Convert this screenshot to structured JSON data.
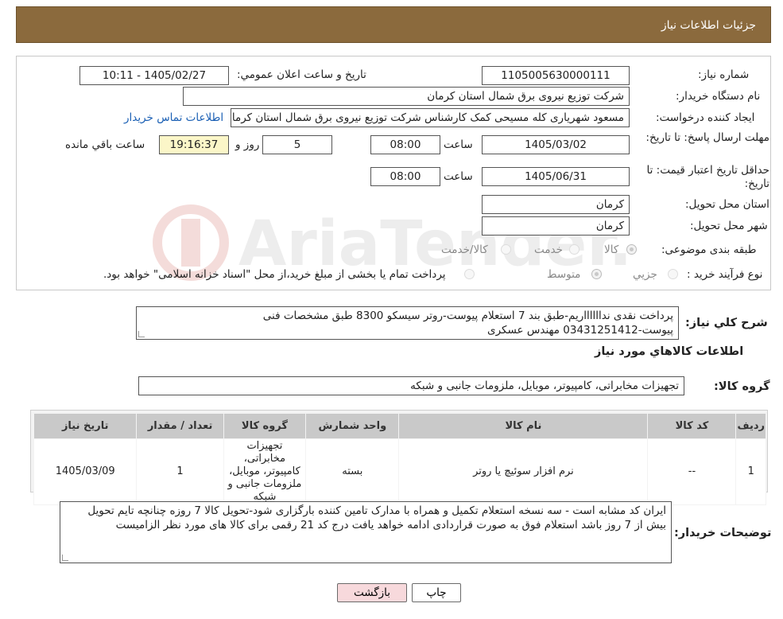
{
  "header": {
    "title": "جزئیات اطلاعات نیاز"
  },
  "form": {
    "need_number_label": "شماره نیاز:",
    "need_number": "1105005630000111",
    "announce_label": "تاریخ و ساعت اعلان عمومي:",
    "announce_value": "1405/02/27 - 10:11",
    "buyer_org_label": "نام دستگاه خریدار:",
    "buyer_org": "شرکت توزیع نیروی برق شمال استان کرمان",
    "requester_label": "ایجاد کننده درخواست:",
    "requester": "مسعود شهریاری کله مسیحی کمک کارشناس شرکت توزیع نیروی برق شمال استان کرمان",
    "contact_link": "اطلاعات تماس خریدار",
    "reply_deadline_label": "مهلت ارسال پاسخ: تا تاریخ:",
    "reply_date": "1405/03/02",
    "time_label": "ساعت",
    "reply_time": "08:00",
    "days_value": "5",
    "days_label": "روز و",
    "remaining_time": "19:16:37",
    "remaining_label": "ساعت باقي مانده",
    "validity_label": "حداقل تاریخ اعتبار قیمت: تا تاریخ:",
    "validity_date": "1405/06/31",
    "validity_time": "08:00",
    "province_label": "استان محل تحویل:",
    "province": "کرمان",
    "city_label": "شهر محل تحویل:",
    "city": "کرمان",
    "category_label": "طبقه بندی موضوعی:",
    "category_options": [
      "کالا",
      "خدمت",
      "کالا/خدمت"
    ],
    "process_label": "نوع فرآیند خرید :",
    "process_options": [
      "جزیي",
      "متوسط"
    ],
    "process_note": "پرداخت تمام یا بخشی از مبلغ خرید،از محل \"اسناد خزانه اسلامی\" خواهد بود."
  },
  "summary": {
    "label": "شرح كلي نياز:",
    "line1": "پرداخت نقدی ندااااااریم-طبق بند 7 استعلام پیوست-روتر سیسکو 8300 طبق مشخصات فنی",
    "line2": "پیوست-03431251412 مهندس عسکری"
  },
  "goods_section": {
    "title": "اطلاعات كالاهاي مورد نياز",
    "group_label": "گروه كالا:",
    "group_value": "تجهیزات مخابراتی، کامپیوتر، موبایل، ملزومات جانبی و شبکه"
  },
  "table": {
    "headers": [
      "ردیف",
      "کد کالا",
      "نام کالا",
      "واحد شمارش",
      "گروه کالا",
      "تعداد / مقدار",
      "تاریخ نیاز"
    ],
    "rows": [
      {
        "row": "1",
        "code": "--",
        "name": "نرم افزار سوئیچ یا روتر",
        "unit": "بسته",
        "group": "تجهیزات مخابراتی، کامپیوتر، موبایل، ملزومات جانبی و شبکه",
        "qty": "1",
        "date": "1405/03/09"
      }
    ]
  },
  "buyer_notes": {
    "label": "توضیحات خریدار:",
    "text": "ایران کد مشابه است - سه نسخه استعلام تکمیل و همراه با مدارک تامین کننده بارگزاری شود-تحویل کالا 7 روزه چنانچه تایم تحویل بیش از 7 روز باشد استعلام فوق به صورت قراردادی ادامه خواهد یافت  درج کد 21 رقمی برای کالا های مورد نظر الزامیست"
  },
  "buttons": {
    "print": "چاپ",
    "back": "بازگشت"
  },
  "colors": {
    "header_bg": "#8b6a3d",
    "back_btn_bg": "#f7d9dc",
    "remaining_bg": "#fbf6c8",
    "link": "#1a5fb4"
  }
}
